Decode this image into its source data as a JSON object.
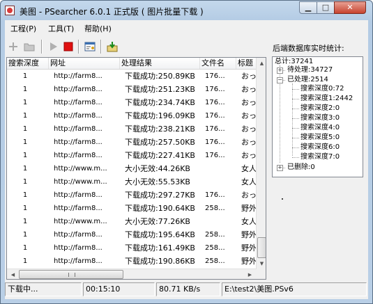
{
  "window": {
    "title": "美图 - PSearcher 6.0.1 正式版 ( 图片批量下载 )"
  },
  "menu": [
    {
      "label": "工程(P)"
    },
    {
      "label": "工具(T)"
    },
    {
      "label": "帮助(H)"
    }
  ],
  "columns": [
    "搜索深度",
    "网址",
    "处理结果",
    "文件名",
    "标题"
  ],
  "rows": [
    [
      "1",
      "http://farm8...",
      "下载成功:250.89KB",
      "176...",
      "おっ"
    ],
    [
      "1",
      "http://farm8...",
      "下载成功:251.23KB",
      "176...",
      "おっ"
    ],
    [
      "1",
      "http://farm8...",
      "下载成功:234.74KB",
      "176...",
      "おっ"
    ],
    [
      "1",
      "http://farm8...",
      "下载成功:196.09KB",
      "176...",
      "おっ"
    ],
    [
      "1",
      "http://farm8...",
      "下载成功:238.21KB",
      "176...",
      "おっ"
    ],
    [
      "1",
      "http://farm8...",
      "下载成功:257.50KB",
      "176...",
      "おっ"
    ],
    [
      "1",
      "http://farm8...",
      "下载成功:227.41KB",
      "176...",
      "おっ"
    ],
    [
      "1",
      "http://www.m...",
      "大小无效:44.26KB",
      "",
      "女人"
    ],
    [
      "1",
      "http://www.m...",
      "大小无效:55.53KB",
      "",
      "女人"
    ],
    [
      "1",
      "http://farm8...",
      "下载成功:297.27KB",
      "176...",
      "おっ"
    ],
    [
      "1",
      "http://farm8...",
      "下载成功:190.64KB",
      "258...",
      "野外"
    ],
    [
      "1",
      "http://www.m...",
      "大小无效:77.26KB",
      "",
      "女人"
    ],
    [
      "1",
      "http://farm8...",
      "下载成功:195.64KB",
      "258...",
      "野外"
    ],
    [
      "1",
      "http://farm8...",
      "下载成功:161.49KB",
      "258...",
      "野外"
    ],
    [
      "1",
      "http://farm8...",
      "下载成功:190.86KB",
      "258...",
      "野外"
    ]
  ],
  "stats": {
    "label": "后端数据库实时统计:",
    "total": "总计:37241",
    "pending": "待处理:34727",
    "processed": "已处理:2514",
    "depths": [
      "搜索深度0:72",
      "搜索深度1:2442",
      "搜索深度2:0",
      "搜索深度3:0",
      "搜索深度4:0",
      "搜索深度5:0",
      "搜索深度6:0",
      "搜索深度7:0"
    ],
    "deleted": "已删除:0"
  },
  "status": {
    "state": "下载中...",
    "elapsed": "00:15:10",
    "speed": "80.71 KB/s",
    "path": "E:\\test2\\美图.PSv6"
  }
}
